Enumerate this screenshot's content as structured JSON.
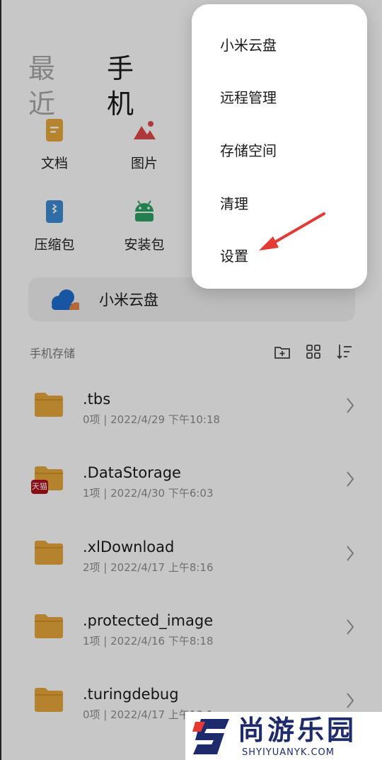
{
  "tabs": {
    "recent": "最近",
    "phone": "手机"
  },
  "categories": [
    {
      "label": "文档",
      "icon": "document-icon"
    },
    {
      "label": "图片",
      "icon": "image-icon"
    },
    {
      "label": "压缩包",
      "icon": "archive-icon"
    },
    {
      "label": "安装包",
      "icon": "android-icon"
    }
  ],
  "cloud_card": {
    "label": "小米云盘",
    "icon": "cloud-icon"
  },
  "storage": {
    "title": "手机存储",
    "tools": [
      "new-folder-icon",
      "grid-view-icon",
      "sort-icon"
    ]
  },
  "files": [
    {
      "name": ".tbs",
      "meta": "0项 | 2022/4/29 下午10:18"
    },
    {
      "name": ".DataStorage",
      "meta": "1项 | 2022/4/30 下午6:03",
      "badge": "天猫"
    },
    {
      "name": ".xlDownload",
      "meta": "2项 | 2022/4/17 上午8:16"
    },
    {
      "name": ".protected_image",
      "meta": "1项 | 2022/4/16 下午8:18"
    },
    {
      "name": ".turingdebug",
      "meta": "0项 | 2022/4/17 上午10:1"
    }
  ],
  "menu": {
    "items": [
      "小米云盘",
      "远程管理",
      "存储空间",
      "清理",
      "设置"
    ],
    "highlighted": "设置"
  },
  "watermark": {
    "cn": "尚游乐园",
    "en": "SHYIYUANYK.COM"
  },
  "colors": {
    "folder": "#E8A73B",
    "accent": "#E53935",
    "brand_blue": "#1d2a6b"
  }
}
